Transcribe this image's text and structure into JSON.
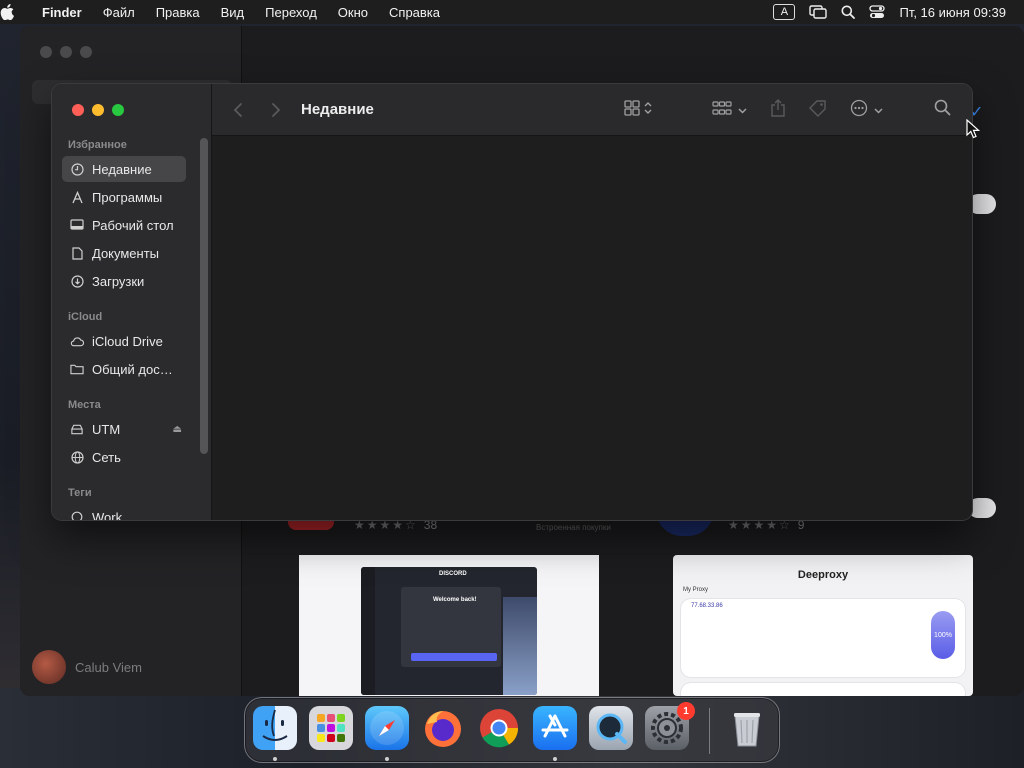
{
  "menubar": {
    "app_name": "Finder",
    "items": [
      "Файл",
      "Правка",
      "Вид",
      "Переход",
      "Окно",
      "Справка"
    ],
    "input_source": "A",
    "datetime": "Пт, 16 июня  09:39"
  },
  "finder": {
    "title": "Недавние",
    "sidebar": {
      "favorites_header": "Избранное",
      "favorites": [
        {
          "label": "Недавние",
          "icon": "clock-icon",
          "selected": true
        },
        {
          "label": "Программы",
          "icon": "applications-icon"
        },
        {
          "label": "Рабочий стол",
          "icon": "desktop-icon"
        },
        {
          "label": "Документы",
          "icon": "document-icon"
        },
        {
          "label": "Загрузки",
          "icon": "download-icon"
        }
      ],
      "icloud_header": "iCloud",
      "icloud": [
        {
          "label": "iCloud Drive",
          "icon": "cloud-icon"
        },
        {
          "label": "Общий дос…",
          "icon": "shared-folder-icon"
        }
      ],
      "locations_header": "Места",
      "locations": [
        {
          "label": "UTM",
          "icon": "disk-icon",
          "eject": true
        },
        {
          "label": "Сеть",
          "icon": "network-icon"
        }
      ],
      "tags_header": "Теги",
      "tags": [
        {
          "label": "Work",
          "icon": "tag-icon"
        }
      ]
    }
  },
  "background_appstore": {
    "user_name": "Calub Viem",
    "left_rating_count": "38",
    "right_rating_count": "9",
    "left_caption": "Встроенная покупки",
    "shot_left_brand": "DISCORD",
    "shot_left_heading": "Welcome back!",
    "shot_right_title": "Deeproxy",
    "shot_right_label": "My Proxy",
    "shot_right_ip": "77.68.33.86",
    "shot_right_percent": "100%"
  },
  "dock": {
    "apps": [
      {
        "name": "Finder",
        "running": true
      },
      {
        "name": "Launchpad",
        "running": false
      },
      {
        "name": "Safari",
        "running": true
      },
      {
        "name": "Firefox",
        "running": false
      },
      {
        "name": "Google Chrome",
        "running": false
      },
      {
        "name": "App Store",
        "running": true
      },
      {
        "name": "QuickTime Player",
        "running": false
      },
      {
        "name": "System Settings",
        "running": false,
        "badge": "1"
      },
      {
        "name": "Trash",
        "running": false
      }
    ]
  }
}
